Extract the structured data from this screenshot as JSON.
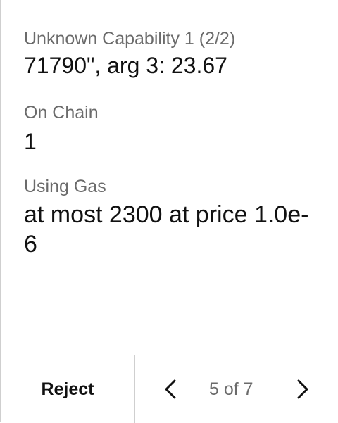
{
  "fields": [
    {
      "label": "Unknown Capability 1 (2/2)",
      "value": "71790\", arg 3: 23.67"
    },
    {
      "label": "On Chain",
      "value": "1"
    },
    {
      "label": "Using Gas",
      "value": "at most 2300 at price 1.0e-6"
    }
  ],
  "footer": {
    "reject_label": "Reject",
    "page_indicator": "5 of 7",
    "prev_icon": "chevron-left-icon",
    "next_icon": "chevron-right-icon"
  }
}
